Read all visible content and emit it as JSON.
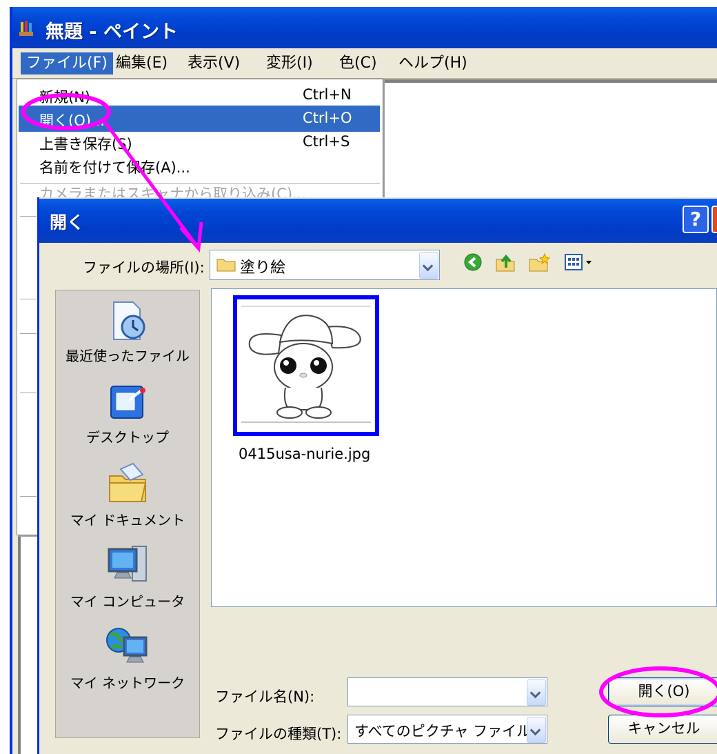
{
  "paint": {
    "title": "無題 - ペイント",
    "menus": [
      "ファイル(F)",
      "編集(E)",
      "表示(V)",
      "変形(I)",
      "色(C)",
      "ヘルプ(H)"
    ]
  },
  "file_menu": {
    "items": [
      {
        "label": "新規(N)",
        "shortcut": "Ctrl+N"
      },
      {
        "label": "開く(O)...",
        "shortcut": "Ctrl+O"
      },
      {
        "label": "上書き保存(S)",
        "shortcut": "Ctrl+S"
      },
      {
        "label": "名前を付けて保存(A)...",
        "shortcut": ""
      }
    ],
    "disabled_item": "カメラまたはスキャナから取り込み(C)..."
  },
  "dialog": {
    "title": "開く",
    "help": "?",
    "lookin_label": "ファイルの場所(I):",
    "lookin_value": "塗り絵",
    "places": [
      "最近使ったファイル",
      "デスクトップ",
      "マイ ドキュメント",
      "マイ コンピュータ",
      "マイ ネットワーク"
    ],
    "files": [
      {
        "name": "0415usa-nurie.jpg"
      }
    ],
    "filename_label": "ファイル名(N):",
    "filename_value": "",
    "filetype_label": "ファイルの種類(T):",
    "filetype_value": "すべてのピクチャ ファイル",
    "open_button": "開く(O)",
    "cancel_button": "キャンセル"
  },
  "colors": {
    "title_blue": "#0247d6",
    "highlight": "#316ac5",
    "annotation": "#ff00ff",
    "selection_border": "#0000ff"
  }
}
